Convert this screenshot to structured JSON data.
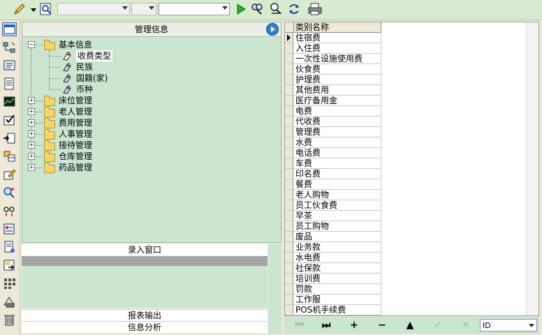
{
  "toolbar": {
    "icons": [
      "pencil-icon",
      "preview-icon",
      "run-icon",
      "search-icon",
      "search-clear-icon",
      "refresh-icon",
      "print-icon"
    ],
    "combo1": {
      "value": ""
    },
    "combo2": {
      "value": ""
    },
    "combo3": {
      "value": ""
    }
  },
  "sidebar": {
    "icons": [
      "window-icon",
      "network-icon",
      "card-icon",
      "document-icon",
      "chart-icon",
      "checkmark-icon",
      "export-icon",
      "grid-icon",
      "edit-icon",
      "find-icon",
      "link-icon",
      "report-icon",
      "receipt-icon",
      "import-icon",
      "apps-icon",
      "tools-icon",
      "trash-icon"
    ]
  },
  "mgmt": {
    "title": "管理信息",
    "tree": {
      "root": "基本信息",
      "children": [
        "收费类型",
        "民族",
        "国籍(家)",
        "币种"
      ],
      "folders": [
        "床位管理",
        "老人管理",
        "费用管理",
        "人事管理",
        "接待管理",
        "仓库管理",
        "药品管理"
      ]
    }
  },
  "entry": {
    "title": "录入窗口"
  },
  "report_button": "报表输出",
  "analysis_button": "信息分析",
  "grid": {
    "column": "类别名称",
    "rows": [
      "住宿费",
      "入住费",
      "一次性设施使用费",
      "伙食费",
      "护理费",
      "其他费用",
      "医疗备用金",
      "电费",
      "代收费",
      "管理费",
      "水费",
      "电话费",
      "车费",
      "印名费",
      "餐费",
      "老人购物",
      "员工伙食费",
      "早茶",
      "员工购物",
      "废品",
      "业务款",
      "水电费",
      "社保款",
      "培训费",
      "罚款",
      "工作服",
      "POS机手续费"
    ]
  },
  "navigator": {
    "buttons": [
      "⏮",
      "⏭",
      "+",
      "−",
      "▲",
      "✓",
      "✕"
    ],
    "field": "ID"
  }
}
